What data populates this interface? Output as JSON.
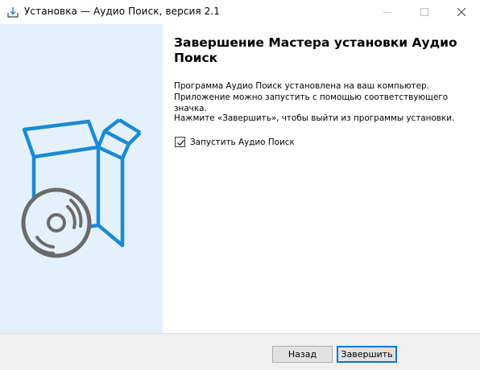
{
  "window": {
    "title": "Установка — Аудио Поиск, версия 2.1",
    "icon": "installer-download-icon",
    "controls": [
      "minimize-icon",
      "maximize-icon",
      "close-icon"
    ]
  },
  "banner": {
    "art": "software-box-with-disc-icon",
    "background": "#e4f1fb",
    "accent": "#1a8ad4",
    "disc_color": "#6b6b6b"
  },
  "main": {
    "heading": "Завершение Мастера установки Аудио Поиск",
    "paragraph1": "Программа Аудио Поиск установлена на ваш компьютер. Приложение можно запустить с помощью соответствующего значка.",
    "paragraph2": "Нажмите «Завершить», чтобы выйти из программы установки.",
    "launch_checkbox": {
      "label": "Запустить Аудио Поиск",
      "checked": true
    }
  },
  "footer": {
    "back_label": "Назад",
    "finish_label": "Завершить"
  }
}
